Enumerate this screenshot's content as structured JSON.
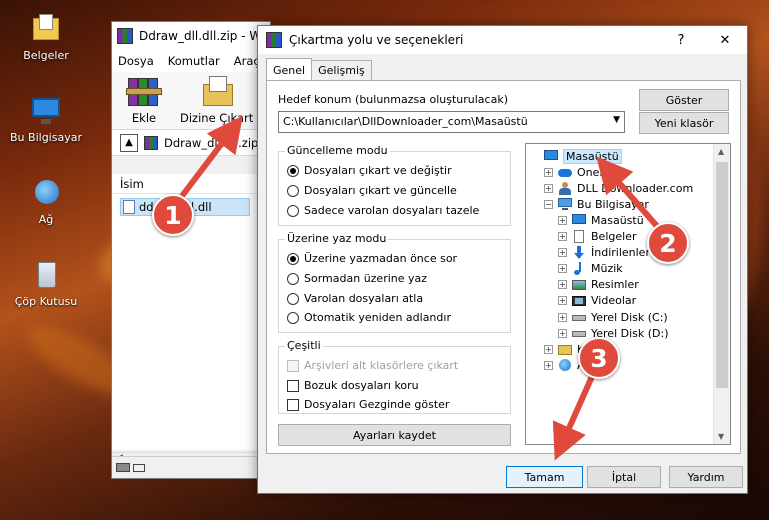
{
  "desktop": {
    "icons": [
      {
        "label": "Belgeler",
        "icon": "documents-folder-icon"
      },
      {
        "label": "Bu Bilgisayar",
        "icon": "this-pc-icon"
      },
      {
        "label": "Ağ",
        "icon": "network-icon"
      },
      {
        "label": "Çöp Kutusu",
        "icon": "recycle-bin-icon"
      }
    ]
  },
  "winrar": {
    "title": "Ddraw_dll.dll.zip - W",
    "menu": [
      "Dosya",
      "Komutlar",
      "Araçla"
    ],
    "toolbar": {
      "add": "Ekle",
      "extract_to": "Dizine Çıkart"
    },
    "address": "Ddraw_dll.dll.zip",
    "column_name": "İsim",
    "file": "ddraw_dll.dll"
  },
  "dialog": {
    "title": "Çıkartma yolu ve seçenekleri",
    "help_btn": "?",
    "close_btn": "✕",
    "tabs": [
      "Genel",
      "Gelişmiş"
    ],
    "dest_label": "Hedef konum (bulunmazsa oluşturulacak)",
    "dest_value": "C:\\Kullanıcılar\\DllDownloader_com\\Masaüstü",
    "show_btn": "Göster",
    "new_folder_btn": "Yeni klasör",
    "update_mode": {
      "title": "Güncelleme modu",
      "options": [
        "Dosyaları çıkart ve değiştir",
        "Dosyaları çıkart ve güncelle",
        "Sadece varolan dosyaları tazele"
      ],
      "selected": 0
    },
    "overwrite_mode": {
      "title": "Üzerine yaz modu",
      "options": [
        "Üzerine yazmadan önce sor",
        "Sormadan üzerine yaz",
        "Varolan dosyaları atla",
        "Otomatik yeniden adlandır"
      ],
      "selected": 0
    },
    "misc": {
      "title": "Çeşitli",
      "options": [
        "Arşivleri alt klasörlere çıkart",
        "Bozuk dosyaları koru",
        "Dosyaları Gezginde göster"
      ]
    },
    "save_settings_btn": "Ayarları kaydet",
    "tree": [
      {
        "label": "Masaüstü",
        "level": 0,
        "expander": "",
        "icon": "desktop-icon",
        "selected": true
      },
      {
        "label": "OneDrive",
        "level": 1,
        "expander": "+",
        "icon": "onedrive-icon"
      },
      {
        "label": "DLL Downloader.com",
        "level": 1,
        "expander": "+",
        "icon": "user-icon"
      },
      {
        "label": "Bu Bilgisayar",
        "level": 1,
        "expander": "−",
        "icon": "computer-icon"
      },
      {
        "label": "Masaüstü",
        "level": 2,
        "expander": "+",
        "icon": "desktop-icon"
      },
      {
        "label": "Belgeler",
        "level": 2,
        "expander": "+",
        "icon": "documents-icon"
      },
      {
        "label": "İndirilenler",
        "level": 2,
        "expander": "+",
        "icon": "downloads-icon"
      },
      {
        "label": "Müzik",
        "level": 2,
        "expander": "+",
        "icon": "music-icon"
      },
      {
        "label": "Resimler",
        "level": 2,
        "expander": "+",
        "icon": "pictures-icon"
      },
      {
        "label": "Videolar",
        "level": 2,
        "expander": "+",
        "icon": "videos-icon"
      },
      {
        "label": "Yerel Disk (C:)",
        "level": 2,
        "expander": "+",
        "icon": "drive-icon"
      },
      {
        "label": "Yerel Disk (D:)",
        "level": 2,
        "expander": "+",
        "icon": "drive-icon"
      },
      {
        "label": "Kitap",
        "level": 1,
        "expander": "+",
        "icon": "library-icon"
      },
      {
        "label": "Ağ",
        "level": 1,
        "expander": "+",
        "icon": "network-icon"
      }
    ],
    "ok_btn": "Tamam",
    "cancel_btn": "İptal",
    "help_text_btn": "Yardım"
  },
  "callouts": [
    "1",
    "2",
    "3"
  ],
  "colors": {
    "callout": "#e04a3c",
    "selection": "#cce8ff",
    "accent": "#0078d7"
  }
}
